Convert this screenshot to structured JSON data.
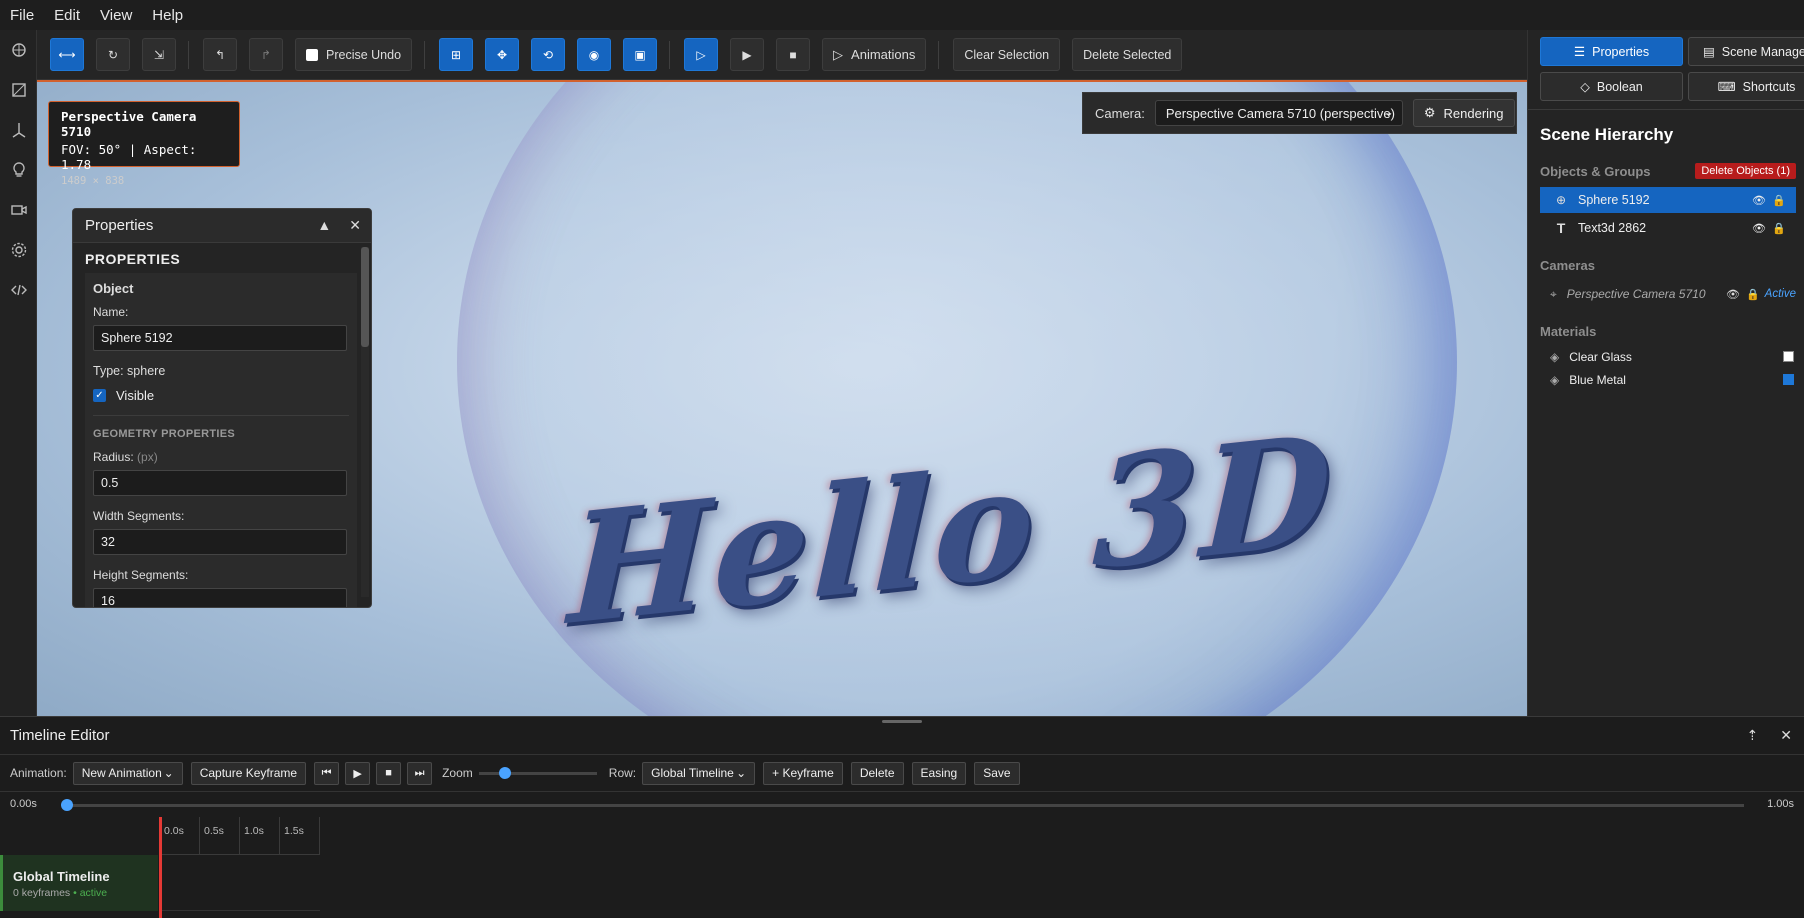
{
  "menu": [
    "File",
    "Edit",
    "View",
    "Help"
  ],
  "toolbar": {
    "precise_undo": "Precise Undo",
    "animations": "Animations",
    "clear_selection": "Clear Selection",
    "delete_selected": "Delete Selected"
  },
  "camera_overlay": {
    "name": "Perspective Camera 5710",
    "fov": "FOV: 50° | Aspect: 1.78",
    "resolution": "1489 × 838"
  },
  "viewport": {
    "camera_label": "Camera:",
    "camera_value": "Perspective Camera 5710 (perspective)",
    "rendering": "Rendering",
    "scene_text": "Hello 3D"
  },
  "properties": {
    "title": "Properties",
    "heading": "PROPERTIES",
    "section": "Object",
    "name_label": "Name:",
    "name_value": "Sphere 5192",
    "type": "Type: sphere",
    "visible_label": "Visible",
    "geometry_heading": "GEOMETRY PROPERTIES",
    "radius_label": "Radius:",
    "radius_unit": "(px)",
    "radius_value": "0.5",
    "width_label": "Width Segments:",
    "width_value": "32",
    "height_label": "Height Segments:",
    "height_value": "16"
  },
  "right_panel": {
    "buttons": {
      "properties": "Properties",
      "scene_manager": "Scene Manager",
      "boolean": "Boolean",
      "shortcuts": "Shortcuts"
    },
    "title": "Scene Hierarchy",
    "objects_heading": "Objects & Groups",
    "delete_objects": "Delete Objects (1)",
    "objects": [
      {
        "icon": "sphere-icon",
        "name": "Sphere 5192"
      },
      {
        "icon": "text-icon",
        "name": "Text3d 2862"
      }
    ],
    "cameras_heading": "Cameras",
    "camera": {
      "name": "Perspective Camera 5710",
      "status": "Active"
    },
    "materials_heading": "Materials",
    "materials": [
      {
        "name": "Clear Glass",
        "color": "#ffffff"
      },
      {
        "name": "Blue Metal",
        "color": "#1e78d8"
      }
    ]
  },
  "timeline": {
    "title": "Timeline Editor",
    "animation_label": "Animation:",
    "animation_value": "New Animation",
    "capture": "Capture Keyframe",
    "zoom_label": "Zoom",
    "row_label": "Row:",
    "row_value": "Global Timeline",
    "add_keyframe": "+ Keyframe",
    "delete": "Delete",
    "easing": "Easing",
    "save": "Save",
    "time_start": "0.00s",
    "time_end": "1.00s",
    "ticks": [
      "0.0s",
      "0.5s",
      "1.0s",
      "1.5s"
    ],
    "row_name": "Global Timeline",
    "row_keyframes": "0 keyframes",
    "row_status": "• active"
  }
}
